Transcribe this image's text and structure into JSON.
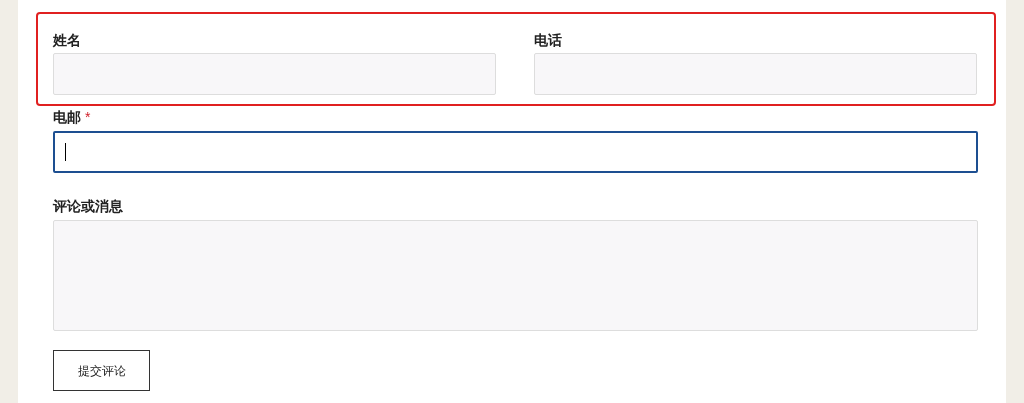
{
  "highlight": {
    "on": true
  },
  "fields": [
    {
      "label": "姓名",
      "required": false,
      "focused": false
    },
    {
      "label": "电话",
      "required": false,
      "focused": false
    }
  ],
  "email": {
    "label": "电邮",
    "required_mark": "*",
    "focused": true
  },
  "comment": {
    "label": "评论或消息",
    "kind": "textarea",
    "focused": false
  },
  "submit": {
    "label": "提交评论"
  }
}
